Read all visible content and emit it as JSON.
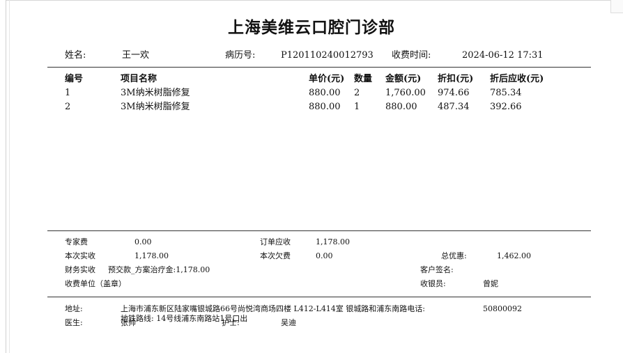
{
  "clinic_name": "上海美维云口腔门诊部",
  "patient": {
    "name_label": "姓名:",
    "name": "王一欢",
    "record_label": "病历号:",
    "record_no": "P120110240012793",
    "time_label": "收费时间:",
    "time": "2024-06-12 17:31"
  },
  "table": {
    "headers": [
      "编号",
      "项目名称",
      "单价(元)",
      "数量",
      "金额(元)",
      "折扣(元)",
      "折后应收(元)"
    ],
    "rows": [
      [
        "1",
        "3M纳米树脂修复",
        "880.00",
        "2",
        "1,760.00",
        "974.66",
        "785.34"
      ],
      [
        "2",
        "3M纳米树脂修复",
        "880.00",
        "1",
        "880.00",
        "487.34",
        "392.66"
      ]
    ]
  },
  "summary": {
    "expert_fee_label": "专家费",
    "expert_fee": "0.00",
    "order_due_label": "订单应收",
    "order_due": "1,178.00",
    "paid_label": "本次实收",
    "paid": "1,178.00",
    "owed_label": "本次欠费",
    "owed": "0.00",
    "total_discount_label": "总优惠:",
    "total_discount": "1,462.00",
    "finance_label": "财务实收",
    "finance_value": "预交款_方案治疗金:1,178.00",
    "customer_sign_label": "客户签名:",
    "unit_label": "收费单位（盖章）",
    "cashier_label": "收银员:",
    "cashier": "曾妮"
  },
  "footer": {
    "address_label": "地址:",
    "address": "上海市浦东新区陆家嘴银城路66号尚悦湾商场四楼 L412-L414室 银城路和浦东南路电话:",
    "phone": "50800092",
    "metro": "地铁路线: 14号线浦东南路站1号口出",
    "doctor_label": "医生:",
    "doctor": "张帅",
    "nurse_label": "护士:",
    "nurse": "吴迪"
  }
}
